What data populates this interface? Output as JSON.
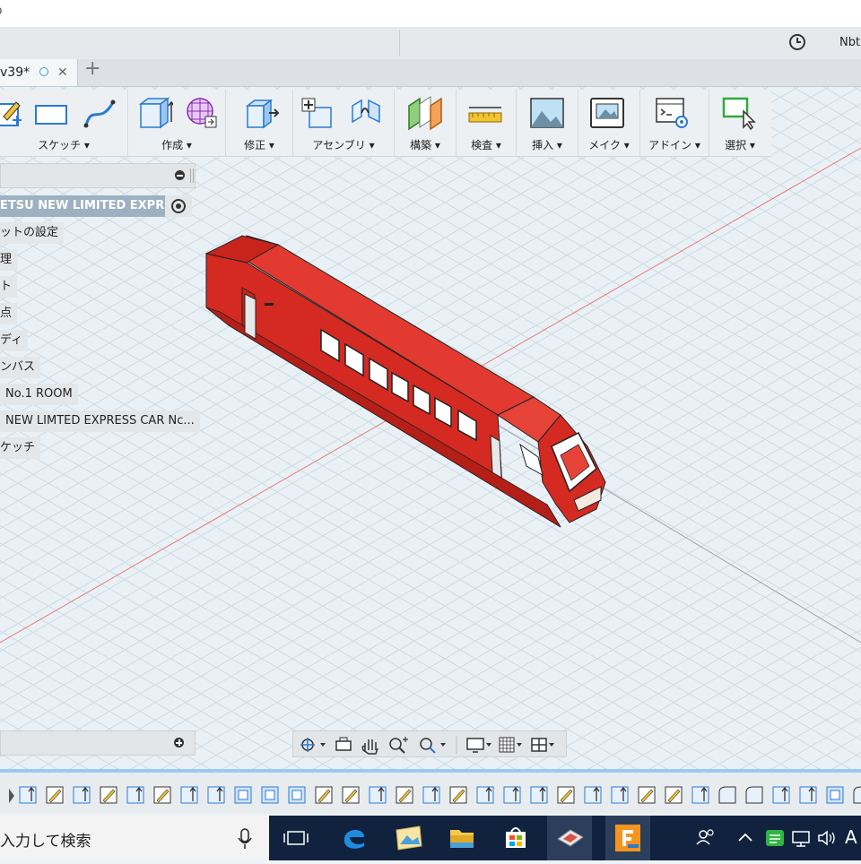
{
  "window": {
    "corner_char": "o",
    "user_name": "Nbta"
  },
  "tab": {
    "label": "v39*",
    "close_char": "✕",
    "add_char": "+"
  },
  "toolbar": {
    "groups": [
      {
        "label": "スケッチ ▾"
      },
      {
        "label": "作成 ▾"
      },
      {
        "label": "修正 ▾"
      },
      {
        "label": "アセンブリ ▾"
      },
      {
        "label": "構築 ▾"
      },
      {
        "label": "検査 ▾"
      },
      {
        "label": "挿入 ▾"
      },
      {
        "label": "メイク ▾"
      },
      {
        "label": "アドイン ▾"
      },
      {
        "label": "選択 ▾"
      }
    ]
  },
  "browser": {
    "root": "ETSU NEW LIMITED EXPR...",
    "nodes": [
      "ットの設定",
      "理",
      "ト",
      "点",
      "ディ",
      "ンバス",
      "No.1 ROOM",
      "NEW LIMTED EXPRESS CAR Nc...",
      "ケッチ"
    ]
  },
  "colors": {
    "accent": "#2a7ad4",
    "model": "#d42a22",
    "timeline_bar": "#9ccaf0",
    "taskbar": "#10223e"
  },
  "taskbar": {
    "search_placeholder": "入力して検索",
    "tray_text": "A"
  },
  "timeline": {
    "icons": [
      "extrude",
      "sketch",
      "extrude",
      "sketch",
      "extrude",
      "sketch",
      "extrude",
      "extrude",
      "box",
      "box",
      "box",
      "sketch",
      "sketch",
      "extrude",
      "sketch",
      "extrude",
      "sketch",
      "extrude",
      "extrude",
      "extrude",
      "sketch",
      "extrude",
      "extrude",
      "sketch",
      "sketch",
      "extrude",
      "fillet",
      "fillet",
      "extrude",
      "extrude",
      "box",
      "fillet"
    ]
  }
}
